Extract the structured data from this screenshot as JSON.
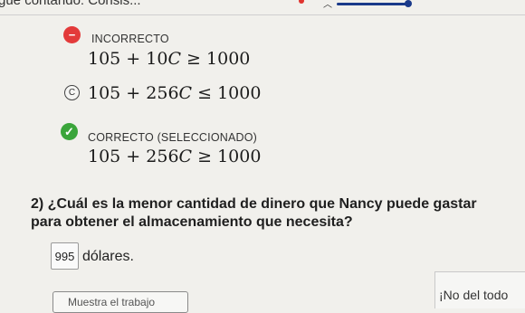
{
  "header": {
    "cut_text": "gue contando: Consis..."
  },
  "options": [
    {
      "status": "INCORRECTO",
      "expression": {
        "lhs": "105 + 10",
        "var": "C",
        "op": "≥",
        "rhs": "1000"
      }
    },
    {
      "letter": "C",
      "expression": {
        "lhs": "105 + 256",
        "var": "C",
        "op": "≤",
        "rhs": "1000"
      }
    },
    {
      "status": "CORRECTO (SELECCIONADO)",
      "expression": {
        "lhs": "105 + 256",
        "var": "C",
        "op": "≥",
        "rhs": "1000"
      }
    }
  ],
  "question": {
    "text": "2) ¿Cuál es la menor cantidad de dinero que Nancy puede gastar para obtener el almacenamiento que necesita?",
    "answer_value": "995",
    "answer_unit": "dólares."
  },
  "footer": {
    "left_button": "Muestra el trabajo",
    "right_button": "¡No del todo"
  }
}
